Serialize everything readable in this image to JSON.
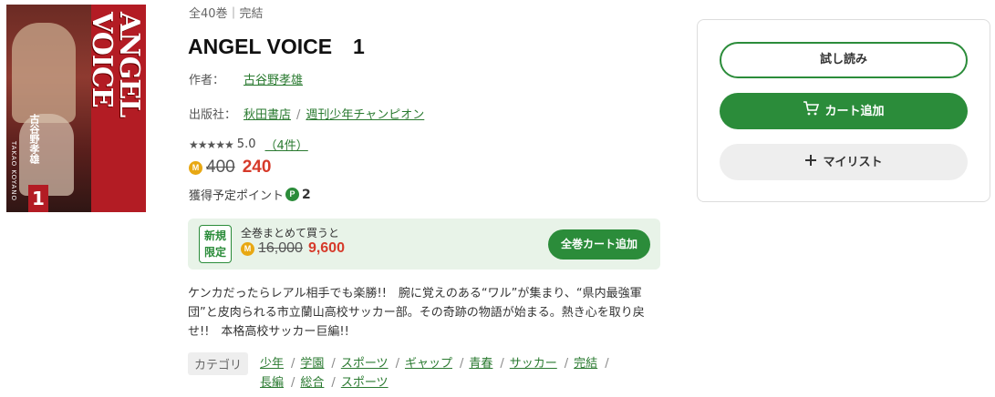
{
  "cover": {
    "title_art": "ANGEL VOICE",
    "volume": "1",
    "author_vertical": "古谷野孝雄",
    "author_romaji": "TAKAO KOYANO"
  },
  "book": {
    "meta": "全40巻｜完結",
    "title": "ANGEL VOICE　1",
    "author_label": "作者：",
    "author": "古谷野孝雄",
    "publisher_label": "出版社：",
    "publisher": "秋田書店",
    "label": "週刊少年チャンピオン",
    "stars": "★★★★★",
    "rating": "5.0",
    "review_count": "（4件）",
    "coin_symbol": "M",
    "old_price": "400",
    "new_price": "240",
    "points_label": "獲得予定ポイント",
    "points_symbol": "P",
    "points": "2"
  },
  "bundle": {
    "badge_line1": "新規",
    "badge_line2": "限定",
    "label": "全巻まとめて買うと",
    "old_price": "16,000",
    "new_price": "9,600",
    "button": "全巻カート追加"
  },
  "description": "ケンカだったらレアル相手でも楽勝!!　腕に覚えのある“ワル”が集まり、“県内最強軍団”と皮肉られる市立蘭山高校サッカー部。その奇跡の物語が始まる。熱き心を取り戻せ!!　本格高校サッカー巨編!!",
  "categories": {
    "label": "カテゴリ",
    "items": [
      "少年",
      "学園",
      "スポーツ",
      "ギャップ",
      "青春",
      "サッカー",
      "完結",
      "長編",
      "総合",
      "スポーツ"
    ]
  },
  "actions": {
    "trial": "試し読み",
    "cart": "カート追加",
    "mylist": "マイリスト",
    "cart_icon": "cart-icon",
    "plus_icon": "plus-icon"
  },
  "colors": {
    "accent_green": "#2b8c3a",
    "price_red": "#d63a2a",
    "coin_gold": "#e8a813"
  }
}
